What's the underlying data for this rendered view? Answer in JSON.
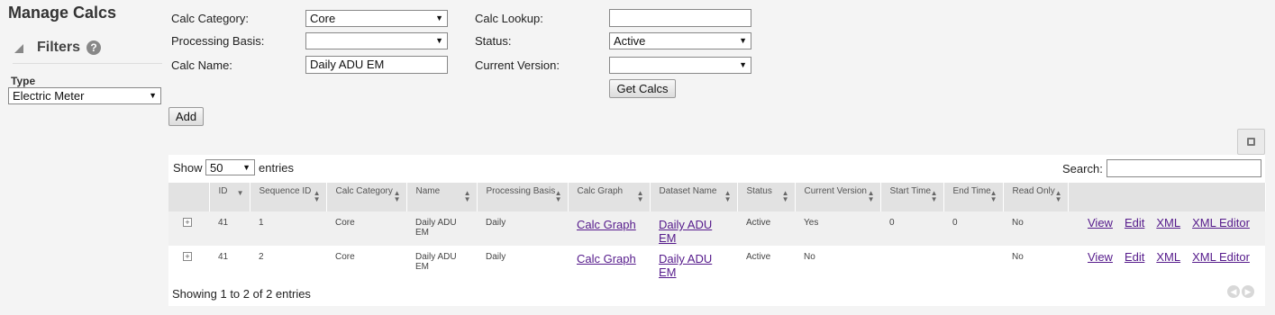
{
  "page": {
    "title": "Manage Calcs"
  },
  "sidebar": {
    "filters_label": "Filters",
    "help_glyph": "?",
    "type_label": "Type",
    "type_value": "Electric Meter"
  },
  "form": {
    "calc_category_label": "Calc Category:",
    "calc_category_value": "Core",
    "processing_basis_label": "Processing Basis:",
    "processing_basis_value": "",
    "calc_name_label": "Calc Name:",
    "calc_name_value": "Daily ADU EM",
    "calc_lookup_label": "Calc Lookup:",
    "calc_lookup_value": "",
    "status_label": "Status:",
    "status_value": "Active",
    "current_version_label": "Current Version:",
    "current_version_value": "",
    "get_calcs_label": "Get Calcs",
    "add_label": "Add"
  },
  "table_controls": {
    "show_label": "Show",
    "entries_value": "50",
    "entries_label": "entries",
    "search_label": "Search:",
    "search_value": "",
    "footer": "Showing 1 to 2 of 2 entries"
  },
  "table": {
    "headers": [
      "",
      "ID",
      "Sequence ID",
      "Calc Category",
      "Name",
      "Processing Basis",
      "Calc Graph",
      "Dataset Name",
      "Status",
      "Current Version",
      "Start Time",
      "End Time",
      "Read Only",
      ""
    ],
    "rows": [
      {
        "id": "41",
        "sequence_id": "1",
        "calc_category": "Core",
        "name": "Daily ADU EM",
        "processing_basis": "Daily",
        "calc_graph": "Calc Graph",
        "dataset_name": "Daily ADU EM",
        "status": "Active",
        "current_version": "Yes",
        "start_time": "0",
        "end_time": "0",
        "read_only": "No",
        "actions": [
          "View",
          "Edit",
          "XML",
          "XML Editor"
        ]
      },
      {
        "id": "41",
        "sequence_id": "2",
        "calc_category": "Core",
        "name": "Daily ADU EM",
        "processing_basis": "Daily",
        "calc_graph": "Calc Graph",
        "dataset_name": "Daily ADU EM",
        "status": "Active",
        "current_version": "No",
        "start_time": "",
        "end_time": "",
        "read_only": "No",
        "actions": [
          "View",
          "Edit",
          "XML",
          "XML Editor"
        ]
      }
    ]
  }
}
